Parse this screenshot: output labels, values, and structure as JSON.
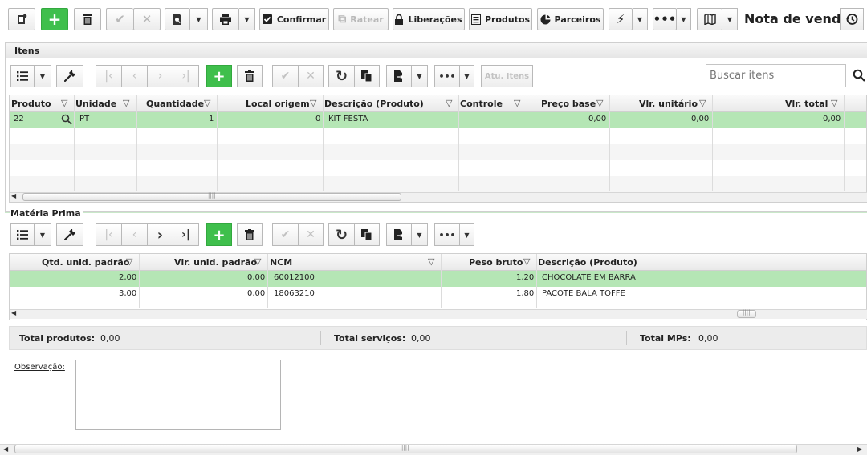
{
  "toolbar": {
    "confirmar": "Confirmar",
    "ratear": "Ratear",
    "liberacoes": "Liberações",
    "produtos": "Produtos",
    "parceiros": "Parceiros",
    "title": "Nota de venda"
  },
  "itens": {
    "title": "Itens",
    "atu_itens": "Atu. Itens",
    "search_placeholder": "Buscar itens",
    "columns": [
      "Produto",
      "Unidade",
      "Quantidade",
      "Local origem",
      "Descrição (Produto)",
      "Controle",
      "Preço base",
      "Vlr. unitário",
      "Vlr. total"
    ],
    "rows": [
      {
        "produto": "22",
        "unidade": "PT",
        "quantidade": "1",
        "local": "0",
        "descricao": "KIT FESTA",
        "controle": "",
        "preco": "0,00",
        "vlr_unit": "0,00",
        "vlr_total": "0,00"
      }
    ]
  },
  "materia": {
    "title": "Matéria Prima",
    "columns": [
      "Qtd. unid. padrão",
      "Vlr. unid. padrão",
      "NCM",
      "Peso bruto",
      "Descrição (Produto)"
    ],
    "rows": [
      {
        "qtd": "2,00",
        "vlr": "0,00",
        "ncm": "60012100",
        "peso": "1,20",
        "descricao": "CHOCOLATE EM BARRA"
      },
      {
        "qtd": "3,00",
        "vlr": "0,00",
        "ncm": "18063210",
        "peso": "1,80",
        "descricao": "PACOTE BALA TOFFE"
      }
    ]
  },
  "totals": {
    "produtos_label": "Total produtos:",
    "produtos_value": "0,00",
    "servicos_label": "Total serviços:",
    "servicos_value": "0,00",
    "mps_label": "Total MPs:",
    "mps_value": "0,00"
  },
  "observacao_label": "Observação:",
  "colors": {
    "accent": "#3fbf4c",
    "selected_row": "#b5e6b5"
  }
}
